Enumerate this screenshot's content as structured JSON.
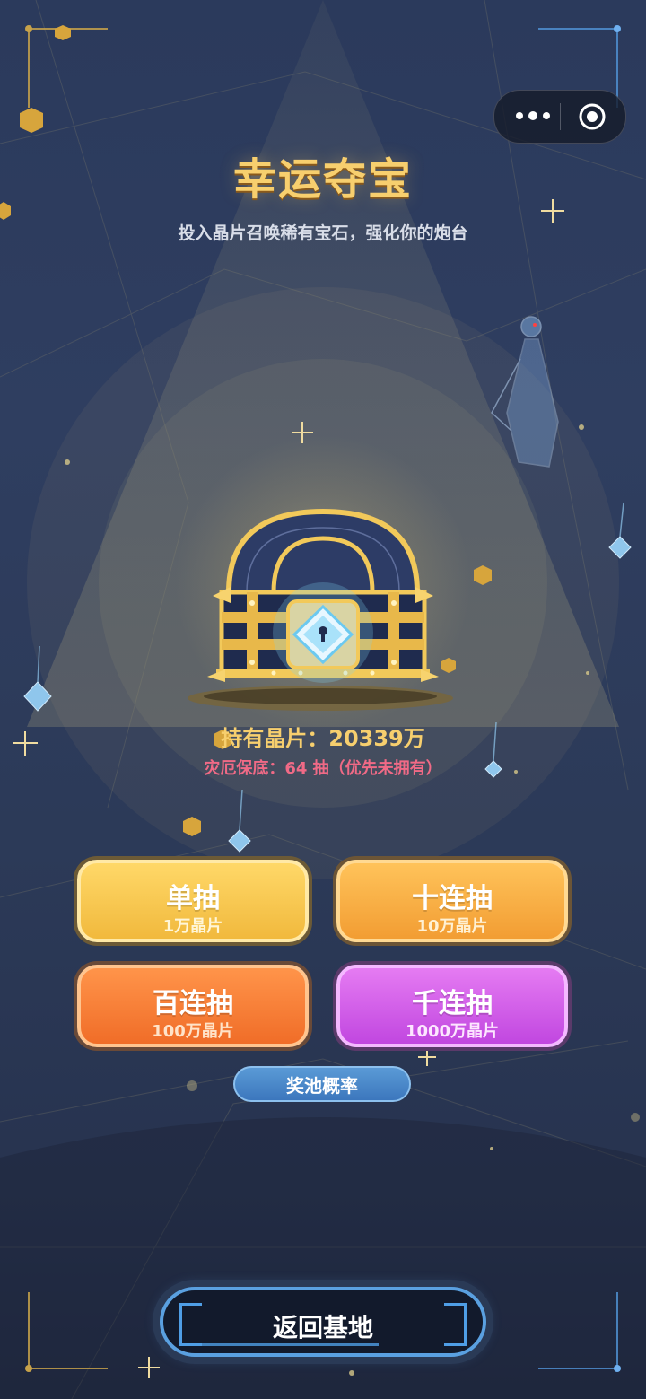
{
  "header": {
    "title": "幸运夺宝",
    "subtitle": "投入晶片召唤稀有宝石，强化你的炮台"
  },
  "miniprogram_capsule": {
    "more_icon": "more-dots-icon",
    "close_icon": "target-close-icon"
  },
  "status": {
    "held": "持有晶片：20339万",
    "pity": "灾厄保底：64 抽（优先未拥有）"
  },
  "draws": [
    {
      "label": "单抽",
      "cost": "1万晶片"
    },
    {
      "label": "十连抽",
      "cost": "10万晶片"
    },
    {
      "label": "百连抽",
      "cost": "100万晶片"
    },
    {
      "label": "千连抽",
      "cost": "1000万晶片"
    }
  ],
  "odds_button": "奖池概率",
  "back_button": "返回基地",
  "colors": {
    "title_gold": "#f7cf6e",
    "pity_pink": "#f06a86",
    "single": "#f1b93d",
    "ten": "#f29d33",
    "hundred": "#f06d28",
    "thousand": "#c147e0",
    "odds_blue": "#3c77bd",
    "back_border": "#5aa0e0"
  }
}
